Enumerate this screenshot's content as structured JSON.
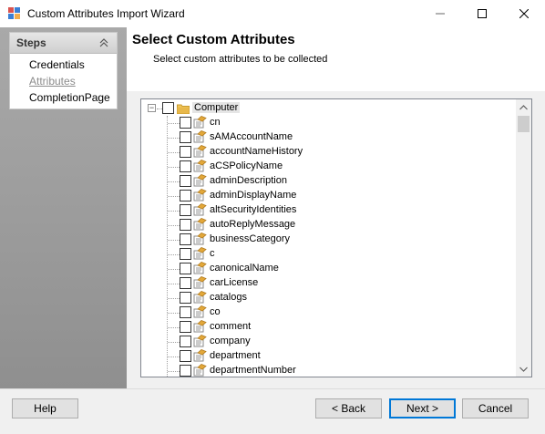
{
  "window": {
    "title": "Custom Attributes Import Wizard"
  },
  "steps": {
    "header": "Steps",
    "items": [
      {
        "label": "Credentials",
        "state": "done"
      },
      {
        "label": "Attributes",
        "state": "current"
      },
      {
        "label": "CompletionPage",
        "state": "pending"
      }
    ]
  },
  "content": {
    "title": "Select Custom Attributes",
    "subtitle": "Select custom attributes to be collected"
  },
  "tree": {
    "root": {
      "label": "Computer",
      "icon": "folder-icon",
      "checked": false
    },
    "children": [
      "cn",
      "sAMAccountName",
      "accountNameHistory",
      "aCSPolicyName",
      "adminDescription",
      "adminDisplayName",
      "altSecurityIdentities",
      "autoReplyMessage",
      "businessCategory",
      "c",
      "canonicalName",
      "carLicense",
      "catalogs",
      "co",
      "comment",
      "company",
      "department",
      "departmentNumber"
    ]
  },
  "buttons": {
    "help": "Help",
    "back": "< Back",
    "next": "Next >",
    "cancel": "Cancel"
  },
  "colors": {
    "accent": "#0078d7",
    "folder": "#e8b84a",
    "step_disabled": "#8c8c8c"
  }
}
